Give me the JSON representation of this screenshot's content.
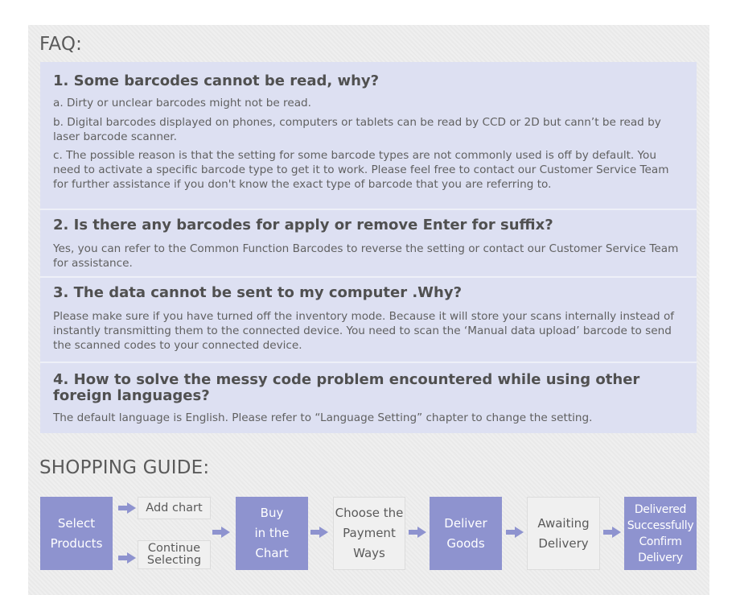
{
  "faq": {
    "title": "FAQ:",
    "items": [
      {
        "question": "1. Some barcodes cannot be read, why?",
        "answers": [
          "a. Dirty or unclear barcodes might not be read.",
          "b. Digital barcodes displayed on phones, computers or tablets can be read by CCD or 2D but cann’t be read by laser barcode scanner.",
          "c. The possible reason is that the setting for some barcode types are not commonly used is off by default. You need to activate a specific barcode type to get it to work. Please feel free to contact our Customer Service Team for further assistance if you don't know the exact type of barcode that you are referring to."
        ]
      },
      {
        "question": "2. Is there any barcodes for apply or remove Enter for suffix?",
        "answers": [
          "Yes, you can refer to the Common Function Barcodes to reverse the setting or contact our Customer Service Team for assistance."
        ]
      },
      {
        "question": "3. The data cannot be sent to my computer .Why?",
        "answers": [
          "Please make sure if you have turned off the inventory mode. Because it will store your scans internally instead of instantly transmitting them to the connected device. You need to scan the ‘Manual data upload’ barcode to send the scanned codes to your connected device."
        ]
      },
      {
        "question": "4. How to solve the messy code problem encountered while using other foreign languages?",
        "answers": [
          "The default language is English. Please refer to “Language Setting” chapter to change the setting."
        ]
      }
    ]
  },
  "shopping_guide": {
    "title": "SHOPPING GUIDE:",
    "steps": {
      "select_products": "Select\nProducts",
      "add_chart": "Add chart",
      "continue_selecting": "Continue\nSelecting",
      "buy_in_chart": "Buy\nin the\nChart",
      "choose_payment": "Choose the\nPayment\nWays",
      "deliver_goods": "Deliver\nGoods",
      "awaiting_delivery": "Awaiting\nDelivery",
      "delivered_confirm": "Delivered\nSuccessfully\nConfirm\nDelivery"
    },
    "colors": {
      "dark_step": "#8e93cf",
      "light_step": "#f0f0f0",
      "arrow": "#8e93cf"
    }
  }
}
